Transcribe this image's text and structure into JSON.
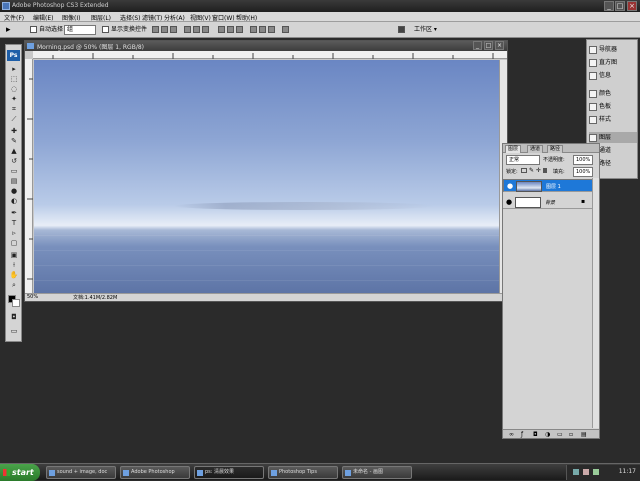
{
  "app": {
    "title": "Adobe Photoshop CS3 Extended"
  },
  "menu": [
    "文件(F)",
    "编辑(E)",
    "图像(I)",
    "图层(L)",
    "选择(S)",
    "滤镜(T)",
    "分析(A)",
    "视图(V)",
    "窗口(W)",
    "帮助(H)"
  ],
  "options": {
    "auto_select_label": "自动选择",
    "auto_select_value": "组",
    "show_transform_label": "显示变换控件",
    "workspace_label": "工作区 ▾"
  },
  "document": {
    "title": "Morning.psd @ 50% (图层 1, RGB/8)",
    "zoom": "50%",
    "status": "文档:1.41M/2.82M"
  },
  "dock": {
    "items": [
      {
        "label": "导航器",
        "icon": "navigator-icon"
      },
      {
        "label": "直方图",
        "icon": "histogram-icon"
      },
      {
        "label": "信息",
        "icon": "info-icon"
      },
      {
        "label": "颜色",
        "icon": "color-icon"
      },
      {
        "label": "色板",
        "icon": "swatches-icon"
      },
      {
        "label": "样式",
        "icon": "styles-icon"
      },
      {
        "label": "图层",
        "icon": "layers-icon"
      },
      {
        "label": "通道",
        "icon": "channels-icon"
      },
      {
        "label": "路径",
        "icon": "paths-icon"
      }
    ]
  },
  "layers_panel": {
    "tabs": [
      "图层",
      "通道",
      "路径"
    ],
    "blend_mode": "正常",
    "opacity_label": "不透明度:",
    "opacity": "100%",
    "lock_label": "锁定:",
    "fill_label": "填充:",
    "fill": "100%",
    "layers": [
      {
        "name": "图层 1",
        "selected": true
      },
      {
        "name": "背景",
        "selected": false
      }
    ]
  },
  "taskbar": {
    "start": "start",
    "buttons": [
      "sound + image, doc",
      "Adobe Photoshop",
      "ps: 清晨效果",
      "Photoshop Tips",
      "未命名 - 画图"
    ],
    "clock": "11:17"
  },
  "colors": {
    "selection": "#1e78d8",
    "sky_top": "#6a86c3",
    "sea": "#5d74a6"
  }
}
